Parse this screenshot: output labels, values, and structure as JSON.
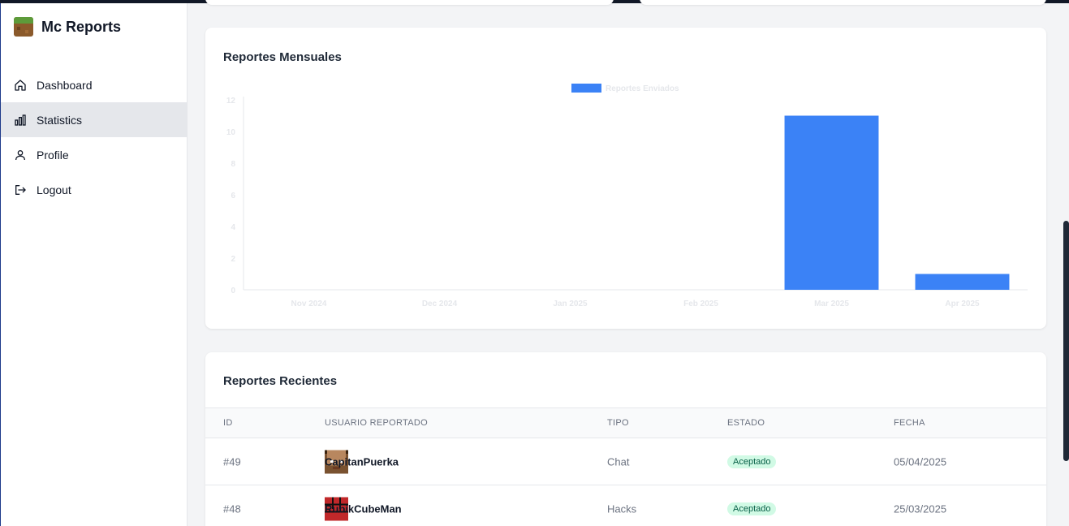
{
  "app": {
    "title": "Mc Reports",
    "logo_icon": "minecraft-grass-block-icon"
  },
  "sidebar": {
    "items": [
      {
        "label": "Dashboard",
        "icon": "home-icon",
        "active": false
      },
      {
        "label": "Statistics",
        "icon": "bar-chart-icon",
        "active": true
      },
      {
        "label": "Profile",
        "icon": "user-icon",
        "active": false
      },
      {
        "label": "Logout",
        "icon": "logout-icon",
        "active": false
      }
    ]
  },
  "chart_card": {
    "title": "Reportes Mensuales"
  },
  "chart_data": {
    "type": "bar",
    "categories": [
      "Nov 2024",
      "Dec 2024",
      "Jan 2025",
      "Feb 2025",
      "Mar 2025",
      "Apr 2025"
    ],
    "series": [
      {
        "name": "Reportes Enviados",
        "values": [
          0,
          0,
          0,
          0,
          11,
          1
        ],
        "color": "#3b82f6"
      }
    ],
    "yticks": [
      0,
      2,
      4,
      6,
      8,
      10,
      12
    ],
    "ylim": [
      0,
      12
    ],
    "grid": false,
    "legend": "top"
  },
  "recent_card": {
    "title": "Reportes Recientes",
    "headers": {
      "id": "ID",
      "user": "USUARIO REPORTADO",
      "tipo": "TIPO",
      "estado": "ESTADO",
      "fecha": "FECHA"
    },
    "rows": [
      {
        "id": "#49",
        "user": "CapitanPuerka",
        "avatar": "steve-avatar-icon",
        "tipo": "Chat",
        "estado": "Aceptado",
        "fecha": "05/04/2025"
      },
      {
        "id": "#48",
        "user": "RubikCubeMan",
        "avatar": "rubik-avatar-icon",
        "tipo": "Hacks",
        "estado": "Aceptado",
        "fecha": "25/03/2025"
      }
    ]
  },
  "colors": {
    "accent": "#3b82f6",
    "badge_bg": "#d1fae5",
    "badge_text": "#065f46",
    "active_nav": "#e5e7eb"
  }
}
